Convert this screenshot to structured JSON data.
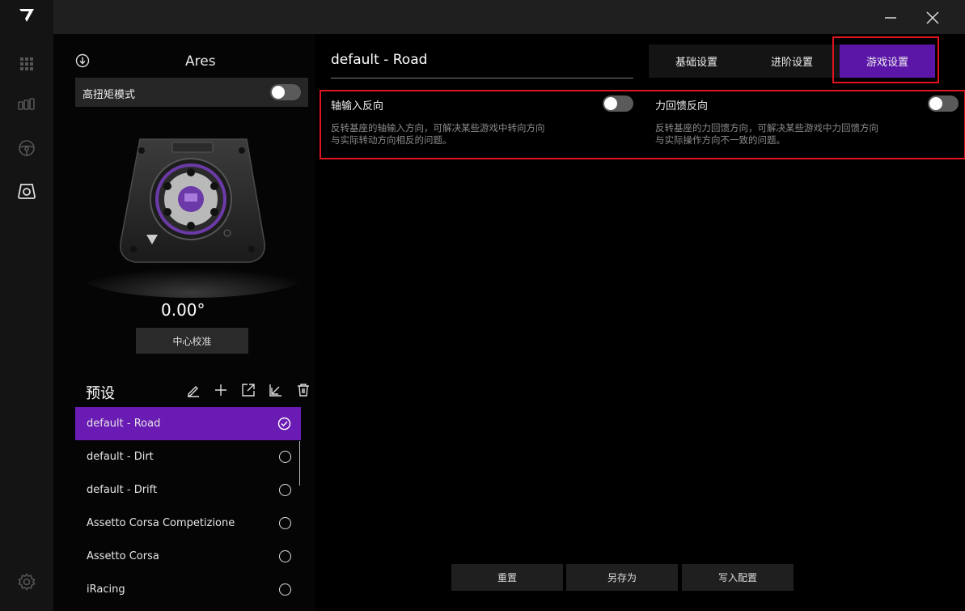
{
  "sidebar": {
    "icons": [
      "logo-icon",
      "apps-grid-icon",
      "pedals-icon",
      "steering-wheel-icon",
      "wheelbase-icon",
      "settings-gear-icon"
    ]
  },
  "window": {
    "minimize": "minimize-icon",
    "close": "close-icon"
  },
  "device": {
    "name": "Ares",
    "high_torque_label": "高扭矩模式",
    "high_torque_on": false,
    "angle": "0.00°",
    "center_calibrate_label": "中心校准"
  },
  "presets": {
    "title": "预设",
    "tools": [
      "edit-icon",
      "add-icon",
      "export-icon",
      "import-icon",
      "delete-icon"
    ],
    "items": [
      {
        "label": "default - Road",
        "active": true
      },
      {
        "label": "default - Dirt",
        "active": false
      },
      {
        "label": "default - Drift",
        "active": false
      },
      {
        "label": "Assetto Corsa Competizione",
        "active": false
      },
      {
        "label": "Assetto Corsa",
        "active": false
      },
      {
        "label": "iRacing",
        "active": false
      }
    ]
  },
  "main": {
    "profile_name": "default - Road",
    "tabs": [
      {
        "label": "基础设置",
        "active": false
      },
      {
        "label": "进阶设置",
        "active": false
      },
      {
        "label": "游戏设置",
        "active": true
      }
    ],
    "settings": [
      {
        "title": "轴输入反向",
        "enabled": false,
        "desc_line1": "反转基座的轴输入方向，可解决某些游戏中转向方向",
        "desc_line2": "与实际转动方向相反的问题。"
      },
      {
        "title": "力回馈反向",
        "enabled": false,
        "desc_line1": "反转基座的力回馈方向，可解决某些游戏中力回馈方向",
        "desc_line2": "与实际操作方向不一致的问题。"
      }
    ],
    "buttons": {
      "reset": "重置",
      "save_as": "另存为",
      "write": "写入配置"
    }
  },
  "colors": {
    "accent": "#6a1bb3",
    "tab_active": "#5b16a8",
    "highlight": "#e0141e"
  }
}
